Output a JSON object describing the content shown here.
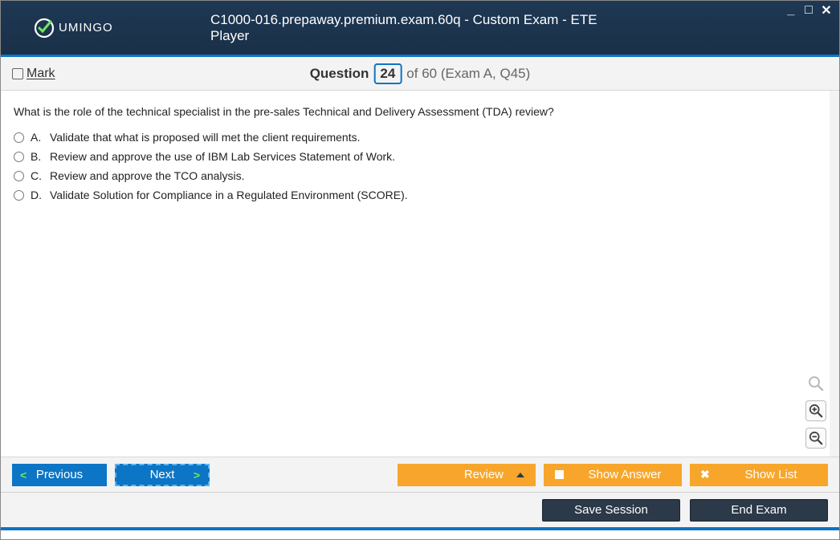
{
  "window": {
    "title": "C1000-016.prepaway.premium.exam.60q - Custom Exam - ETE Player",
    "logo_text": "UMINGO"
  },
  "header": {
    "mark_label": "Mark",
    "question_label": "Question",
    "current_number": "24",
    "total_text": "of 60 (Exam A, Q45)"
  },
  "question": {
    "text": "What is the role of the technical specialist in the pre-sales Technical and Delivery Assessment (TDA) review?",
    "answers": [
      {
        "letter": "A.",
        "text": "Validate that what is proposed will met the client requirements."
      },
      {
        "letter": "B.",
        "text": "Review and approve the use of IBM Lab Services Statement of Work."
      },
      {
        "letter": "C.",
        "text": "Review and approve the TCO analysis."
      },
      {
        "letter": "D.",
        "text": "Validate Solution for Compliance in a Regulated Environment (SCORE)."
      }
    ]
  },
  "footer": {
    "previous": "Previous",
    "next": "Next",
    "review": "Review",
    "show_answer": "Show Answer",
    "show_list": "Show List",
    "save_session": "Save Session",
    "end_exam": "End Exam"
  }
}
